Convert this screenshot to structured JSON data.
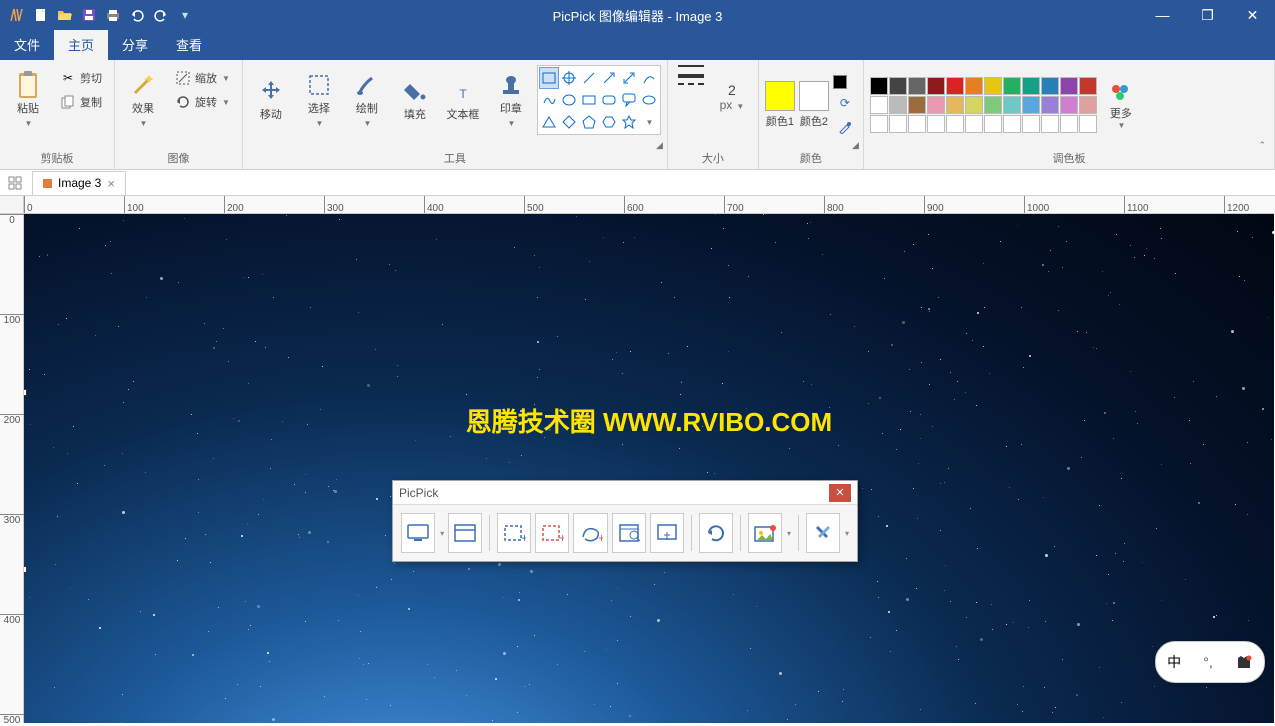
{
  "title": "PicPick 图像编辑器 - Image 3",
  "menus": {
    "file": "文件",
    "home": "主页",
    "share": "分享",
    "view": "查看"
  },
  "groups": {
    "clipboard": "剪贴板",
    "image": "图像",
    "tools": "工具",
    "size": "大小",
    "color": "颜色",
    "palette": "调色板"
  },
  "btns": {
    "paste": "粘贴",
    "cut": "剪切",
    "copy": "复制",
    "effect": "效果",
    "resize": "缩放",
    "rotate": "旋转",
    "move": "移动",
    "select": "选择",
    "draw": "绘制",
    "fill": "填充",
    "text": "文本框",
    "stamp": "印章",
    "color1": "颜色1",
    "color2": "颜色2",
    "more": "更多"
  },
  "size": {
    "value": "2",
    "unit": "px"
  },
  "tab": {
    "name": "Image 3"
  },
  "ruler_h": [
    "0",
    "100",
    "200",
    "300",
    "400",
    "500",
    "600",
    "700",
    "800",
    "900",
    "1000",
    "1100",
    "1200"
  ],
  "ruler_v": [
    "0",
    "100",
    "200",
    "300",
    "400",
    "500"
  ],
  "watermark": "恩腾技术圈 WWW.RVIBO.COM",
  "float": {
    "title": "PicPick"
  },
  "ime": {
    "lang": "中"
  },
  "palette_rows": [
    [
      "#000",
      "#444",
      "#666",
      "#8b1a1a",
      "#d22",
      "#e67e22",
      "#e6c60f",
      "#27ae60",
      "#16a085",
      "#2980b9",
      "#8e44ad",
      "#c0392b"
    ],
    [
      "#fff",
      "#bbb",
      "#9c6b3e",
      "#e89bb0",
      "#e6b85c",
      "#d4d462",
      "#7fc97f",
      "#6ec8c8",
      "#5aa7e0",
      "#9b7fd4",
      "#d07fd0",
      "#e0a0a0"
    ],
    [
      "#fff",
      "#fff",
      "#fff",
      "#fff",
      "#fff",
      "#fff",
      "#fff",
      "#fff",
      "#fff",
      "#fff",
      "#fff",
      "#fff"
    ]
  ],
  "color1": "#ffff00",
  "color2": "#ffffff",
  "mini": "#000000"
}
